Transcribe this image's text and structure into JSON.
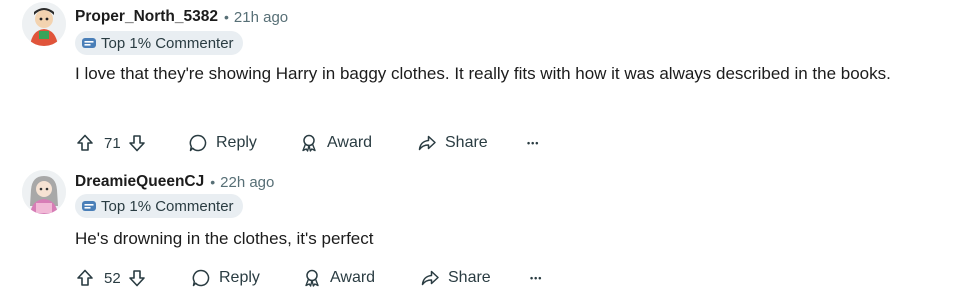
{
  "comments": [
    {
      "username": "Proper_North_5382",
      "separator": "•",
      "time": "21h ago",
      "badge": "Top 1% Commenter",
      "text": "I love that they're showing Harry in baggy clothes. It really fits with how it was always described in the books.",
      "votes": "71",
      "reply_label": "Reply",
      "award_label": "Award",
      "share_label": "Share",
      "more_label": "•••"
    },
    {
      "username": "DreamieQueenCJ",
      "separator": "•",
      "time": "22h ago",
      "badge": "Top 1% Commenter",
      "text": "He's drowning in the clothes, it's perfect",
      "votes": "52",
      "reply_label": "Reply",
      "award_label": "Award",
      "share_label": "Share",
      "more_label": "•••"
    }
  ],
  "icons": {
    "upvote": "arrow-up-icon",
    "downvote": "arrow-down-icon",
    "reply": "speech-bubble-icon",
    "award": "award-ribbon-icon",
    "share": "share-arrow-icon",
    "badge": "commenter-badge-icon"
  },
  "colors": {
    "badge_bg": "#e9eef2",
    "meta": "#576f76",
    "text": "#1c1c1c"
  }
}
